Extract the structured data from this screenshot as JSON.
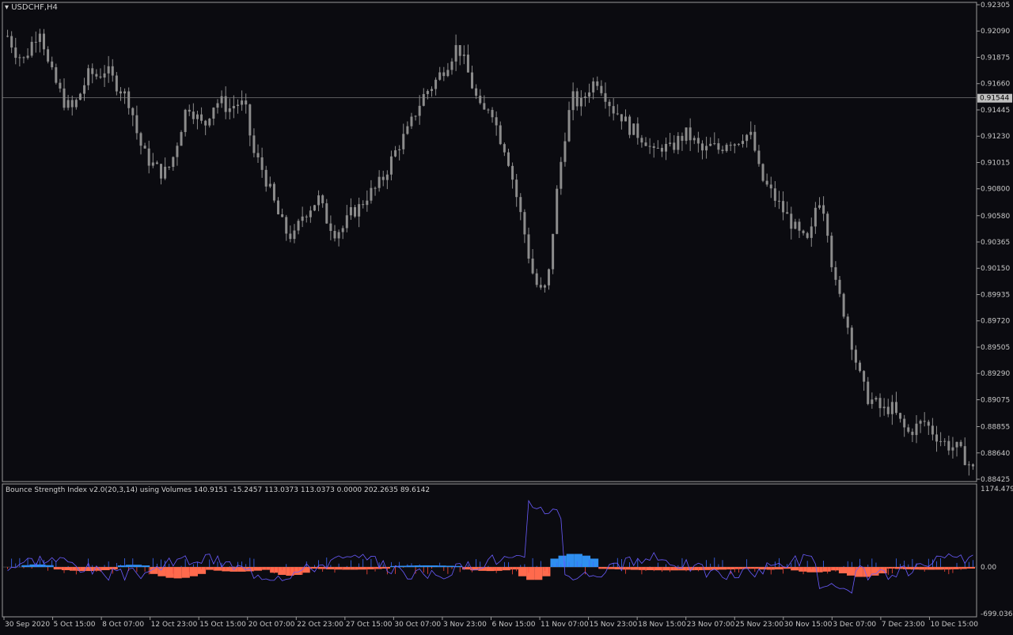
{
  "chart_data": [
    {
      "type": "candlestick",
      "symbol_label": "USDCHF,H4",
      "price_axis": {
        "ticks": [
          "0.92305",
          "0.92090",
          "0.91875",
          "0.91660",
          "0.91445",
          "0.91230",
          "0.91015",
          "0.90800",
          "0.90580",
          "0.90365",
          "0.90150",
          "0.89935",
          "0.89720",
          "0.89505",
          "0.89290",
          "0.89075",
          "0.88855",
          "0.88640",
          "0.88425"
        ],
        "range": [
          0.88425,
          0.92305
        ]
      },
      "current_price_label": "0.91544",
      "current_price": 0.91544,
      "time_axis": [
        "30 Sep 2020",
        "5 Oct 15:00",
        "8 Oct 07:00",
        "12 Oct 23:00",
        "15 Oct 15:00",
        "20 Oct 07:00",
        "22 Oct 23:00",
        "27 Oct 15:00",
        "30 Oct 07:00",
        "3 Nov 23:00",
        "6 Nov 15:00",
        "11 Nov 07:00",
        "15 Nov 23:00",
        "18 Nov 15:00",
        "23 Nov 07:00",
        "25 Nov 23:00",
        "30 Nov 15:00",
        "3 Dec 07:00",
        "7 Dec 23:00",
        "10 Dec 15:00"
      ],
      "close_path": [
        0.9205,
        0.9192,
        0.9185,
        0.92,
        0.9212,
        0.918,
        0.9165,
        0.915,
        0.9145,
        0.916,
        0.9175,
        0.9172,
        0.9178,
        0.9168,
        0.916,
        0.915,
        0.912,
        0.9105,
        0.9098,
        0.9092,
        0.91,
        0.9125,
        0.915,
        0.914,
        0.913,
        0.9148,
        0.9152,
        0.9145,
        0.915,
        0.9148,
        0.911,
        0.9098,
        0.908,
        0.906,
        0.9045,
        0.904,
        0.9058,
        0.9065,
        0.9072,
        0.9055,
        0.9045,
        0.9048,
        0.906,
        0.9065,
        0.9075,
        0.908,
        0.909,
        0.9105,
        0.9118,
        0.9128,
        0.9145,
        0.9158,
        0.9165,
        0.9175,
        0.9185,
        0.9198,
        0.918,
        0.916,
        0.914,
        0.915,
        0.9125,
        0.911,
        0.908,
        0.905,
        0.9015,
        0.8995,
        0.9,
        0.907,
        0.912,
        0.9155,
        0.9148,
        0.9162,
        0.917,
        0.9158,
        0.9145,
        0.914,
        0.913,
        0.9125,
        0.912,
        0.9108,
        0.9115,
        0.9112,
        0.912,
        0.9125,
        0.9118,
        0.911,
        0.9115,
        0.9112,
        0.912,
        0.9118,
        0.9125,
        0.9122,
        0.909,
        0.908,
        0.907,
        0.906,
        0.905,
        0.904,
        0.9035,
        0.9075,
        0.906,
        0.9005,
        0.8985,
        0.896,
        0.893,
        0.891,
        0.8905,
        0.8898,
        0.8902,
        0.889,
        0.888,
        0.8885,
        0.889,
        0.8882,
        0.8875,
        0.887,
        0.8868,
        0.886,
        0.885
      ]
    },
    {
      "type": "histogram",
      "indicator_label": "Bounce Strength Index v2.0(20,3,14) using Volumes 140.9151 -15.2457 113.0373 113.0373 0.0000 202.2635 89.6142",
      "axis": {
        "top": "1174.4795",
        "zero": "0.00",
        "bottom": "-699.0369"
      },
      "range": [
        -699.0369,
        1174.4795
      ],
      "blocks": [
        {
          "from": 2,
          "to": 6,
          "value": 40
        },
        {
          "from": 6,
          "to": 14,
          "value": -60
        },
        {
          "from": 14,
          "to": 18,
          "value": 35
        },
        {
          "from": 18,
          "to": 25,
          "value": -170
        },
        {
          "from": 25,
          "to": 33,
          "value": -70
        },
        {
          "from": 33,
          "to": 38,
          "value": -130
        },
        {
          "from": 38,
          "to": 48,
          "value": -40
        },
        {
          "from": 48,
          "to": 57,
          "value": 25
        },
        {
          "from": 57,
          "to": 64,
          "value": -60
        },
        {
          "from": 64,
          "to": 68,
          "value": -200
        },
        {
          "from": 68,
          "to": 74,
          "value": 200
        },
        {
          "from": 74,
          "to": 93,
          "value": -50
        },
        {
          "from": 93,
          "to": 98,
          "value": -40
        },
        {
          "from": 98,
          "to": 104,
          "value": -80
        },
        {
          "from": 104,
          "to": 110,
          "value": -150
        },
        {
          "from": 110,
          "to": 121,
          "value": -40
        }
      ]
    }
  ]
}
